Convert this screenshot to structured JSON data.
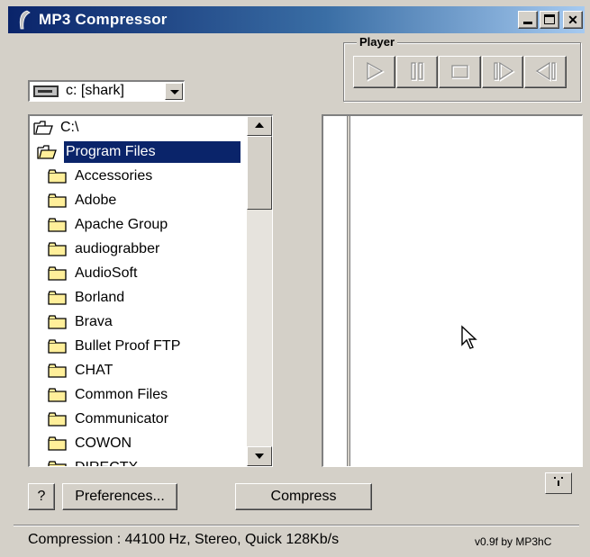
{
  "window": {
    "title": "MP3 Compressor",
    "icon": "app-icon",
    "controls": [
      {
        "name": "minimize-button",
        "glyph": "_"
      },
      {
        "name": "maximize-button",
        "glyph": "□"
      },
      {
        "name": "close-button",
        "glyph": "×"
      }
    ]
  },
  "drive": {
    "selected": "c: [shark]",
    "icon": "drive-icon"
  },
  "player": {
    "label": "Player",
    "buttons": [
      "play",
      "pause",
      "stop",
      "next",
      "previous"
    ]
  },
  "tree": {
    "root": "C:\\",
    "selected": "Program Files",
    "items": [
      "Accessories",
      "Adobe",
      "Apache Group",
      "audiograbber",
      "AudioSoft",
      "Borland",
      "Brava",
      "Bullet Proof FTP",
      "CHAT",
      "Common Files",
      "Communicator",
      "COWON",
      "DIRECTX"
    ]
  },
  "buttons": {
    "help": "?",
    "preferences": "Preferences...",
    "compress": "Compress"
  },
  "status": {
    "compression": "Compression : 44100 Hz, Stereo,  Quick 128Kb/s",
    "version": "v0.9f by MP3hC"
  },
  "colors": {
    "titlebar": "#0a246a",
    "selection": "#0a246a",
    "face": "#d4d0c8"
  }
}
